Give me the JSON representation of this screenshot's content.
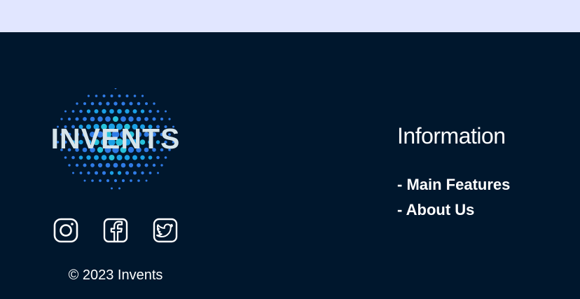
{
  "footer": {
    "logo_text": "INVENTS",
    "copyright": "© 2023 Invents",
    "social": [
      {
        "icon": "instagram-icon"
      },
      {
        "icon": "facebook-icon"
      },
      {
        "icon": "twitter-icon"
      }
    ],
    "info": {
      "heading": "Information",
      "links": [
        {
          "label": "- Main Features"
        },
        {
          "label": "- About Us"
        }
      ]
    }
  },
  "colors": {
    "top_band": "#e1e6ff",
    "footer_bg": "#00172d",
    "logo_dot_blue": "#2f7be6",
    "logo_dot_cyan": "#27c3dc",
    "text": "#ffffff"
  }
}
